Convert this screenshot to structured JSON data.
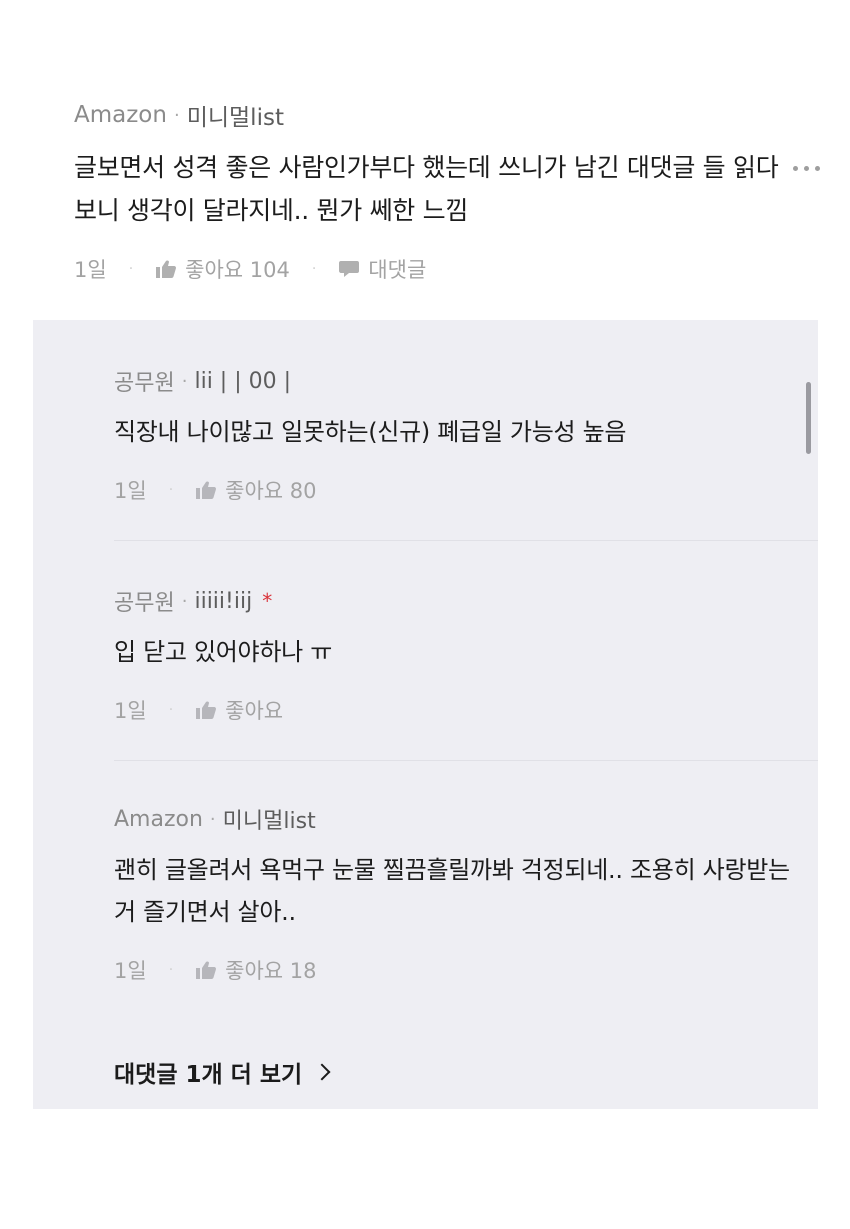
{
  "top_comment": {
    "company": "Amazon",
    "separator": "·",
    "nickname": "미니멀list",
    "text": "글보면서 성격 좋은 사람인가부다 했는데 쓰니가 남긴 대댓글 들 읽다보니 생각이 달라지네.. 뭔가 쎄한 느낌",
    "time": "1일",
    "like_label": "좋아요 104",
    "reply_label": "대댓글"
  },
  "replies": [
    {
      "company": "공무원",
      "nickname": "lii |   | 00 |",
      "text": "직장내 나이많고 일못하는(신규) 폐급일 가능성 높음",
      "time": "1일",
      "like_label": "좋아요 80",
      "author_star": ""
    },
    {
      "company": "공무원",
      "nickname": "iiiii!iij",
      "text": "입 닫고 있어야하나 ㅠ",
      "time": "1일",
      "like_label": "좋아요",
      "author_star": "*"
    },
    {
      "company": "Amazon",
      "nickname": "미니멀list",
      "text": "괜히 글올려서 욕먹구 눈물 찔끔흘릴까봐 걱정되네.. 조용히 사랑받는 거 즐기면서 살아..",
      "time": "1일",
      "like_label": "좋아요 18",
      "author_star": ""
    }
  ],
  "more_replies_label": "대댓글 1개 더 보기",
  "icons": {
    "like": "thumbs-up-icon",
    "reply": "speech-bubble-icon",
    "more": "more-horizontal-icon",
    "chevron": "chevron-right-icon"
  },
  "colors": {
    "panel_bg": "#eeeef3",
    "meta_gray": "#8b8b8b",
    "star_red": "#d9333a"
  }
}
